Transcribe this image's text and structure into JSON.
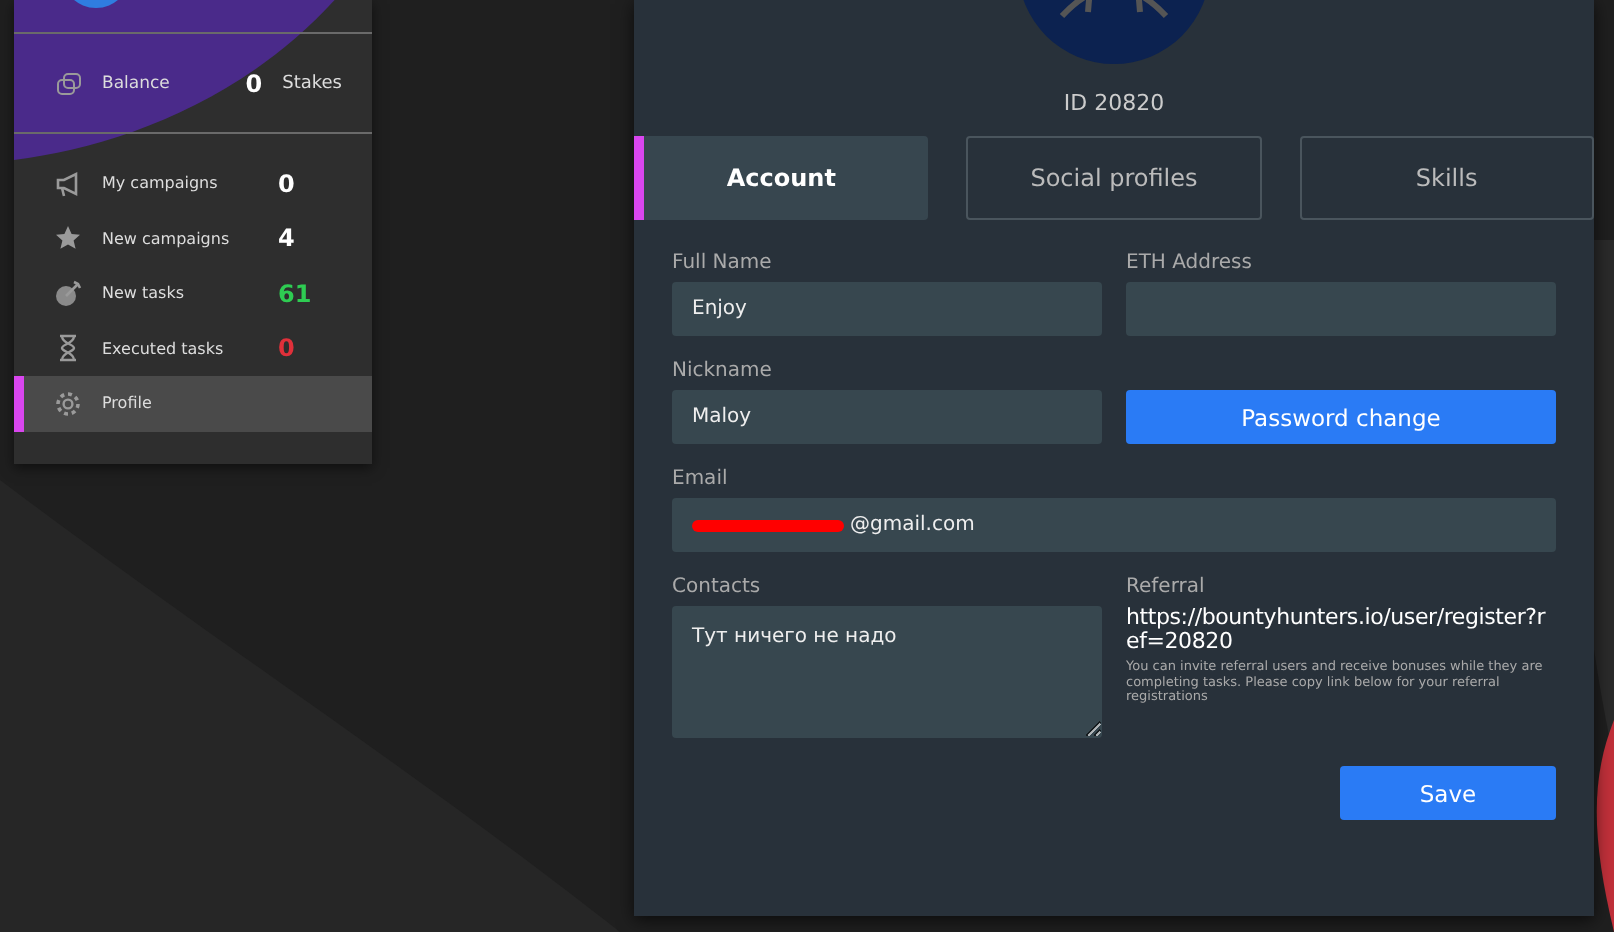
{
  "sidebar": {
    "balance": {
      "label": "Balance",
      "value": "0",
      "unit": "Stakes"
    },
    "items": [
      {
        "label": "My campaigns",
        "count": "0",
        "color": "#ffffff",
        "selected": false
      },
      {
        "label": "New campaigns",
        "count": "4",
        "color": "#ffffff",
        "selected": false
      },
      {
        "label": "New tasks",
        "count": "61",
        "color": "#2ecc52",
        "selected": false
      },
      {
        "label": "Executed tasks",
        "count": "0",
        "color": "#e0303a",
        "selected": false
      },
      {
        "label": "Profile",
        "selected": true
      }
    ]
  },
  "profile": {
    "id": "ID 20820",
    "tabs": [
      {
        "label": "Account",
        "selected": true
      },
      {
        "label": "Social profiles",
        "selected": false
      },
      {
        "label": "Skills",
        "selected": false
      }
    ],
    "full_name": {
      "label": "Full Name",
      "value": "Enjoy"
    },
    "eth_address": {
      "label": "ETH Address"
    },
    "nickname": {
      "label": "Nickname",
      "value": "Maloy"
    },
    "password_button": "Password change",
    "email": {
      "label": "Email",
      "value": "@gmail.com"
    },
    "contacts": {
      "label": "Contacts",
      "value": "Тут ничего не надо"
    },
    "referral": {
      "label": "Referral",
      "link": "https://bountyhunters.io/user/register?ref=20820",
      "note": "You can invite referral users and receive bonuses while they are completing tasks. Please copy link below for your referral registrations"
    },
    "save_button": "Save"
  }
}
